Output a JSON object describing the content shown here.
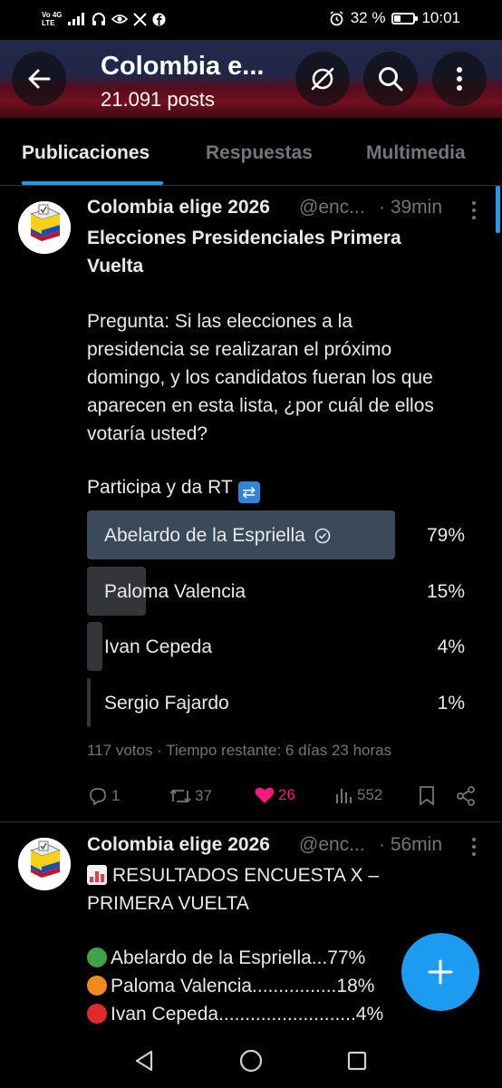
{
  "status_bar": {
    "net_top": "Vo 4G",
    "net_bottom": "LTE",
    "battery": "32 %",
    "time": "10:01"
  },
  "header": {
    "title": "Colombia e...",
    "posts_count": "21.091 posts"
  },
  "tabs": [
    "Publicaciones",
    "Respuestas",
    "Multimedia"
  ],
  "tweet1": {
    "name": "Colombia elige 2026",
    "handle": "@enc...",
    "time": "· 39min",
    "headline_1": "Elecciones Presidenciales Primera",
    "headline_2": "Vuelta",
    "question_1": "Pregunta: Si las elecciones a la",
    "question_2": "presidencia se realizaran el próximo",
    "question_3": "domingo, y los candidatos fueran los que",
    "question_4": "aparecen en esta lista, ¿por cuál de ellos",
    "question_5": "votaría usted?",
    "cta": "Participa y da RT",
    "poll": [
      {
        "label": "Abelardo de la Espriella",
        "pct": "79%",
        "fraction": 0.79
      },
      {
        "label": "Paloma Valencia",
        "pct": "15%",
        "fraction": 0.15
      },
      {
        "label": "Ivan Cepeda",
        "pct": "4%",
        "fraction": 0.04
      },
      {
        "label": "Sergio Fajardo",
        "pct": "1%",
        "fraction": 0.01
      }
    ],
    "poll_meta": "117 votos · Tiempo restante: 6 días 23 horas",
    "replies": "1",
    "reposts": "37",
    "likes": "26",
    "views": "552"
  },
  "tweet2": {
    "name": "Colombia elige 2026",
    "handle": "@enc...",
    "time": "· 56min",
    "line_1": "RESULTADOS ENCUESTA X –",
    "line_2": "PRIMERA VUELTA",
    "result_1": "Abelardo de la Espriella...77%",
    "result_2": "Paloma Valencia................18%",
    "result_3": "Ivan Cepeda..........................4%"
  },
  "colors": {
    "accent": "#1d9bf0",
    "like": "#f91880",
    "muted": "#71767b",
    "green_dot": "#3fa34d",
    "orange_dot": "#f08a1c",
    "red_dot": "#e02b2b"
  }
}
